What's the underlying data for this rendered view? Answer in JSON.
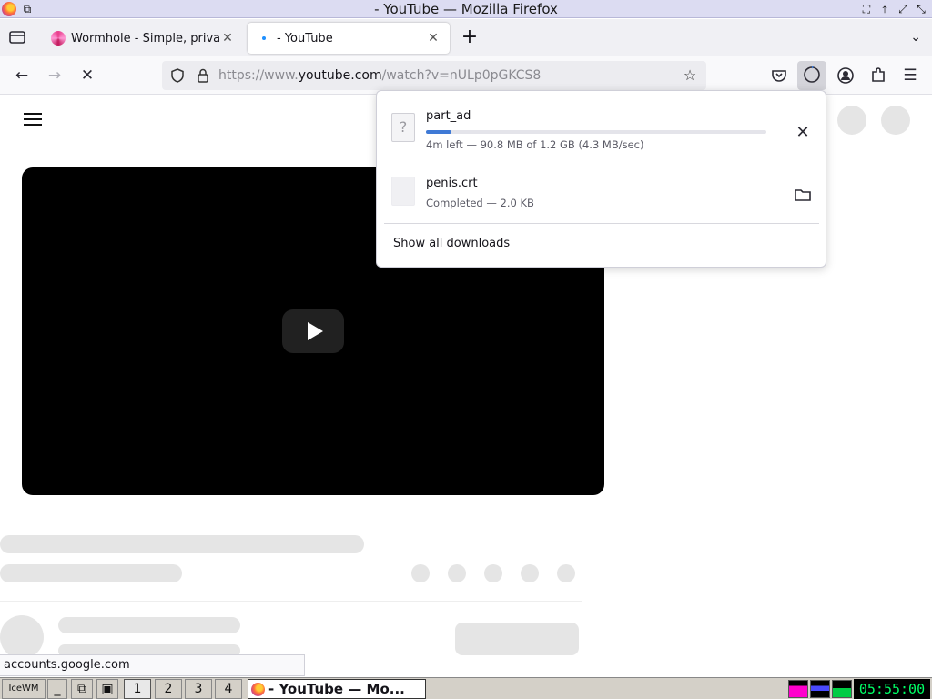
{
  "window": {
    "title": "- YouTube — Mozilla Firefox"
  },
  "tabs": [
    {
      "label": "Wormhole - Simple, private",
      "icon": "wormhole-icon",
      "active": false
    },
    {
      "label": "- YouTube",
      "icon": "youtube-loading-icon",
      "active": true
    }
  ],
  "toolbar": {
    "url_prefix": "https://www.",
    "url_host": "youtube.com",
    "url_path": "/watch?v=nULp0pGKCS8"
  },
  "downloads": {
    "items": [
      {
        "name": "part_ad",
        "status": "4m left — 90.8 MB of 1.2 GB (4.3 MB/sec)",
        "progress": 0.075,
        "action": "cancel"
      },
      {
        "name": "penis.crt",
        "status": "Completed — 2.0 KB",
        "action": "open-folder"
      }
    ],
    "show_all_label": "Show all downloads"
  },
  "status_bar": {
    "url": "accounts.google.com"
  },
  "taskbar": {
    "workspaces": [
      "1",
      "2",
      "3",
      "4"
    ],
    "active_window": "- YouTube — Mo...",
    "clock": "05:55:00"
  },
  "colors": {
    "accent": "#3f7ad6",
    "title_bar": "#dcdcf2",
    "clock_text": "#00ff66"
  }
}
